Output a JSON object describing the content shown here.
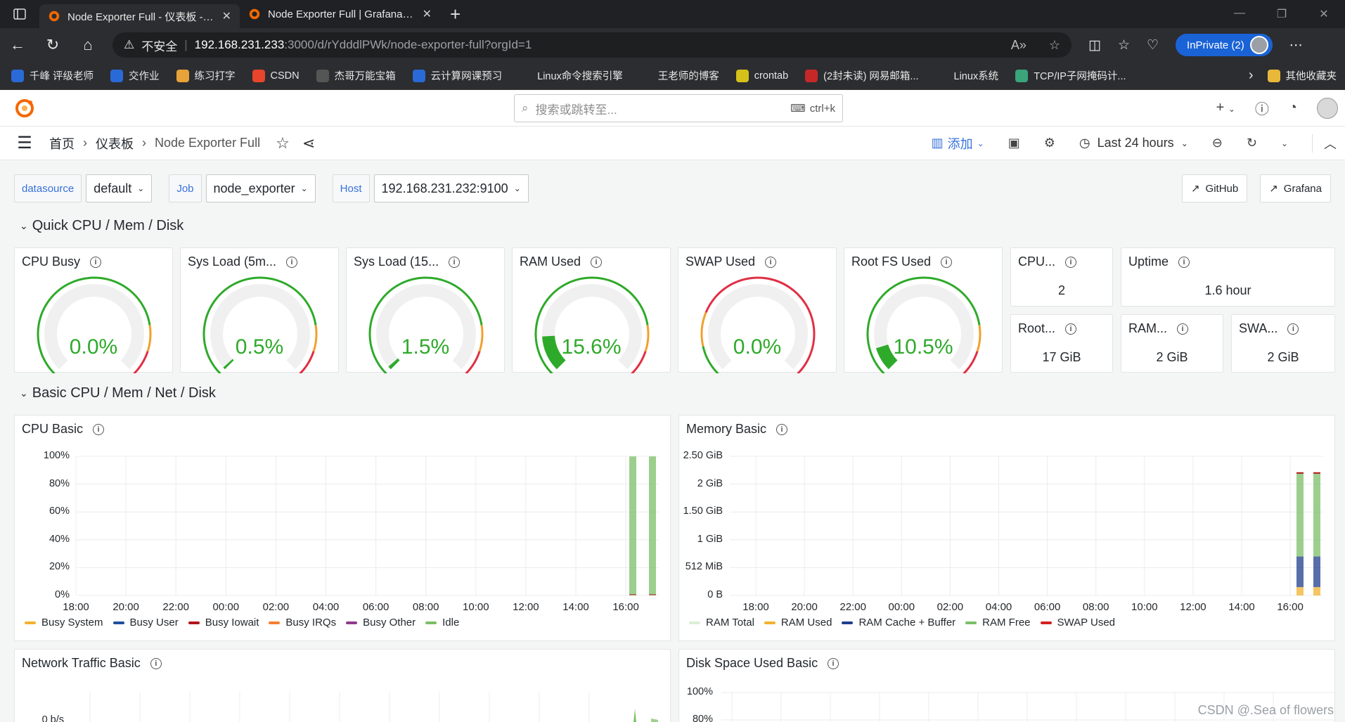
{
  "browser": {
    "tabs": [
      {
        "title": "Node Exporter Full - 仪表板 - Grafana"
      },
      {
        "title": "Node Exporter Full | Grafana Labs"
      }
    ],
    "omnibox": {
      "security": "不安全",
      "host": "192.168.231.233",
      "path": ":3000/d/rYdddlPWk/node-exporter-full?orgId=1"
    },
    "inprivate_label": "InPrivate (2)",
    "bookmarks": [
      {
        "label": "千峰 评级老师",
        "color": "#2a6ad6"
      },
      {
        "label": "交作业",
        "color": "#2a6ad6"
      },
      {
        "label": "练习打字",
        "color": "#e8a23a"
      },
      {
        "label": "CSDN",
        "color": "#e8452c"
      },
      {
        "label": "杰哥万能宝箱",
        "color": "#555555"
      },
      {
        "label": "云计算网课预习",
        "color": "#2a6ad6"
      },
      {
        "label": "Linux命令搜索引擎",
        "color": "#2c2d30"
      },
      {
        "label": "王老师的博客",
        "color": "#2c2d30"
      },
      {
        "label": "crontab",
        "color": "#d4c21a"
      },
      {
        "label": "(2封未读) 网易邮箱...",
        "color": "#c62828"
      },
      {
        "label": "Linux系统",
        "color": "#2c2d30"
      },
      {
        "label": "TCP/IP子网掩码计...",
        "color": "#3aa47a"
      }
    ],
    "other_bookmarks": "其他收藏夹"
  },
  "grafana": {
    "search_placeholder": "搜索或跳转至...",
    "search_shortcut": "ctrl+k",
    "breadcrumb": {
      "home": "首页",
      "dashboards": "仪表板",
      "current": "Node Exporter Full"
    },
    "add_label": "添加",
    "time_range": "Last 24 hours"
  },
  "variables": [
    {
      "label": "datasource",
      "value": "default"
    },
    {
      "label": "Job",
      "value": "node_exporter"
    },
    {
      "label": "Host",
      "value": "192.168.231.232:9100"
    }
  ],
  "links": {
    "github": "GitHub",
    "grafana": "Grafana"
  },
  "rows": {
    "quick": "Quick CPU / Mem / Disk",
    "basic": "Basic CPU / Mem / Net / Disk"
  },
  "gauges": [
    {
      "title": "CPU Busy",
      "value": "0.0%",
      "fraction": 0.0
    },
    {
      "title": "Sys Load (5m...",
      "value": "0.5%",
      "fraction": 0.005
    },
    {
      "title": "Sys Load (15...",
      "value": "1.5%",
      "fraction": 0.015
    },
    {
      "title": "RAM Used",
      "value": "15.6%",
      "fraction": 0.156
    },
    {
      "title": "SWAP Used",
      "value": "0.0%",
      "fraction": 0.0
    },
    {
      "title": "Root FS Used",
      "value": "10.5%",
      "fraction": 0.105
    }
  ],
  "stats": [
    {
      "title": "CPU...",
      "value": "2"
    },
    {
      "title": "Uptime",
      "value": "1.6 hour"
    },
    {
      "title": "Root...",
      "value": "17 GiB"
    },
    {
      "title": "RAM...",
      "value": "2 GiB"
    },
    {
      "title": "SWA...",
      "value": "2 GiB"
    }
  ],
  "panels": {
    "cpu_basic": "CPU Basic",
    "memory_basic": "Memory Basic",
    "network_basic": "Network Traffic Basic",
    "disk_basic": "Disk Space Used Basic"
  },
  "cpu_chart": {
    "yticks": [
      "100%",
      "80%",
      "60%",
      "40%",
      "20%",
      "0%"
    ],
    "xticks": [
      "18:00",
      "20:00",
      "22:00",
      "00:00",
      "02:00",
      "04:00",
      "06:00",
      "08:00",
      "10:00",
      "12:00",
      "14:00",
      "16:00"
    ],
    "legend": [
      {
        "name": "Busy System",
        "color": "#f2b22e"
      },
      {
        "name": "Busy User",
        "color": "#1f4e9c"
      },
      {
        "name": "Busy Iowait",
        "color": "#b3151b"
      },
      {
        "name": "Busy IRQs",
        "color": "#f77f2e"
      },
      {
        "name": "Busy Other",
        "color": "#8e3b8c"
      },
      {
        "name": "Idle",
        "color": "#7bbf67"
      }
    ]
  },
  "mem_chart": {
    "yticks": [
      "2.50 GiB",
      "2 GiB",
      "1.50 GiB",
      "1 GiB",
      "512 MiB",
      "0 B"
    ],
    "xticks": [
      "18:00",
      "20:00",
      "22:00",
      "00:00",
      "02:00",
      "04:00",
      "06:00",
      "08:00",
      "10:00",
      "12:00",
      "14:00",
      "16:00"
    ],
    "legend": [
      {
        "name": "RAM Total",
        "color": "#dcefd8"
      },
      {
        "name": "RAM Used",
        "color": "#f2b22e"
      },
      {
        "name": "RAM Cache + Buffer",
        "color": "#1f3e8c"
      },
      {
        "name": "RAM Free",
        "color": "#7bbf67"
      },
      {
        "name": "SWAP Used",
        "color": "#d42020"
      }
    ]
  },
  "net_chart": {
    "ytick": "0 b/s"
  },
  "disk_chart": {
    "yticks": [
      "100%",
      "80%"
    ]
  },
  "chart_data": [
    {
      "type": "area",
      "title": "CPU Basic",
      "x": [
        "16:35",
        "16:50"
      ],
      "series": [
        {
          "name": "Busy System",
          "values": [
            0.5,
            0.5
          ]
        },
        {
          "name": "Busy User",
          "values": [
            0.3,
            0.3
          ]
        },
        {
          "name": "Busy Iowait",
          "values": [
            0.1,
            0.1
          ]
        },
        {
          "name": "Busy IRQs",
          "values": [
            0,
            0
          ]
        },
        {
          "name": "Busy Other",
          "values": [
            0,
            0
          ]
        },
        {
          "name": "Idle",
          "values": [
            99,
            99
          ]
        }
      ],
      "ylim": [
        0,
        100
      ]
    },
    {
      "type": "area",
      "title": "Memory Basic",
      "x": [
        "16:35",
        "16:50"
      ],
      "series": [
        {
          "name": "RAM Total",
          "values": [
            2.2,
            2.2
          ]
        },
        {
          "name": "RAM Used",
          "values": [
            0.15,
            0.15
          ]
        },
        {
          "name": "RAM Cache + Buffer",
          "values": [
            0.55,
            0.55
          ]
        },
        {
          "name": "RAM Free",
          "values": [
            1.5,
            1.5
          ]
        },
        {
          "name": "SWAP Used",
          "values": [
            0,
            0
          ]
        }
      ],
      "ylim": [
        0,
        2.5
      ]
    }
  ],
  "watermark": "CSDN @.Sea of flowers"
}
